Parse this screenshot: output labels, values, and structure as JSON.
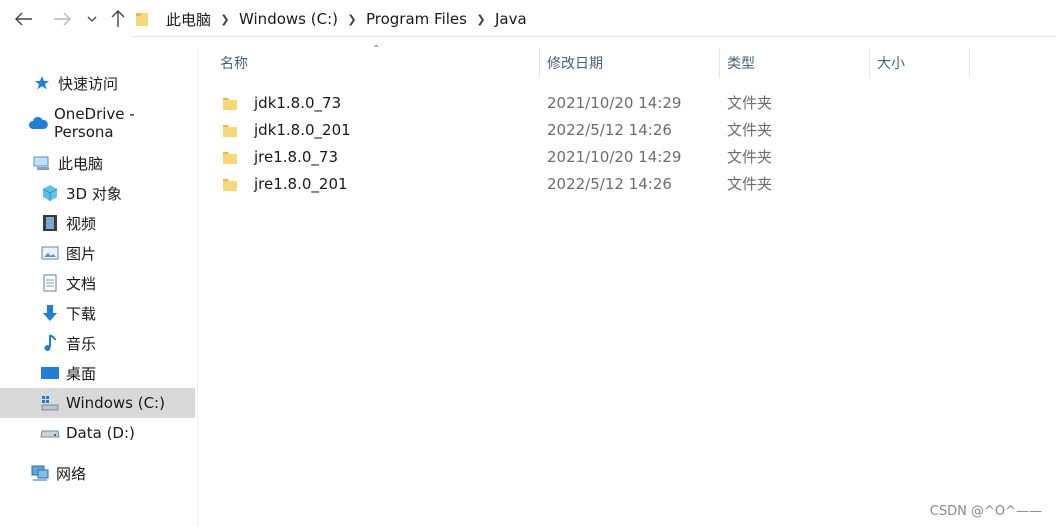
{
  "breadcrumb": [
    "此电脑",
    "Windows (C:)",
    "Program Files",
    "Java"
  ],
  "columns": {
    "name": "名称",
    "date": "修改日期",
    "type": "类型",
    "size": "大小"
  },
  "sidebar": {
    "quick_access": "快速访问",
    "onedrive": "OneDrive - Persona",
    "this_pc": "此电脑",
    "items": [
      "3D 对象",
      "视频",
      "图片",
      "文档",
      "下载",
      "音乐",
      "桌面",
      "Windows (C:)",
      "Data (D:)"
    ],
    "network": "网络"
  },
  "files": [
    {
      "name": "jdk1.8.0_73",
      "date": "2021/10/20 14:29",
      "type": "文件夹"
    },
    {
      "name": "jdk1.8.0_201",
      "date": "2022/5/12 14:26",
      "type": "文件夹"
    },
    {
      "name": "jre1.8.0_73",
      "date": "2021/10/20 14:29",
      "type": "文件夹"
    },
    {
      "name": "jre1.8.0_201",
      "date": "2022/5/12 14:26",
      "type": "文件夹"
    }
  ],
  "watermark": "CSDN @^O^——",
  "colors": {
    "folder": "#f8d775",
    "folder_dark": "#e9b949",
    "selected_bg": "#d9d9d9",
    "header_text": "#4c607a",
    "accent_blue": "#1e7fd8"
  }
}
